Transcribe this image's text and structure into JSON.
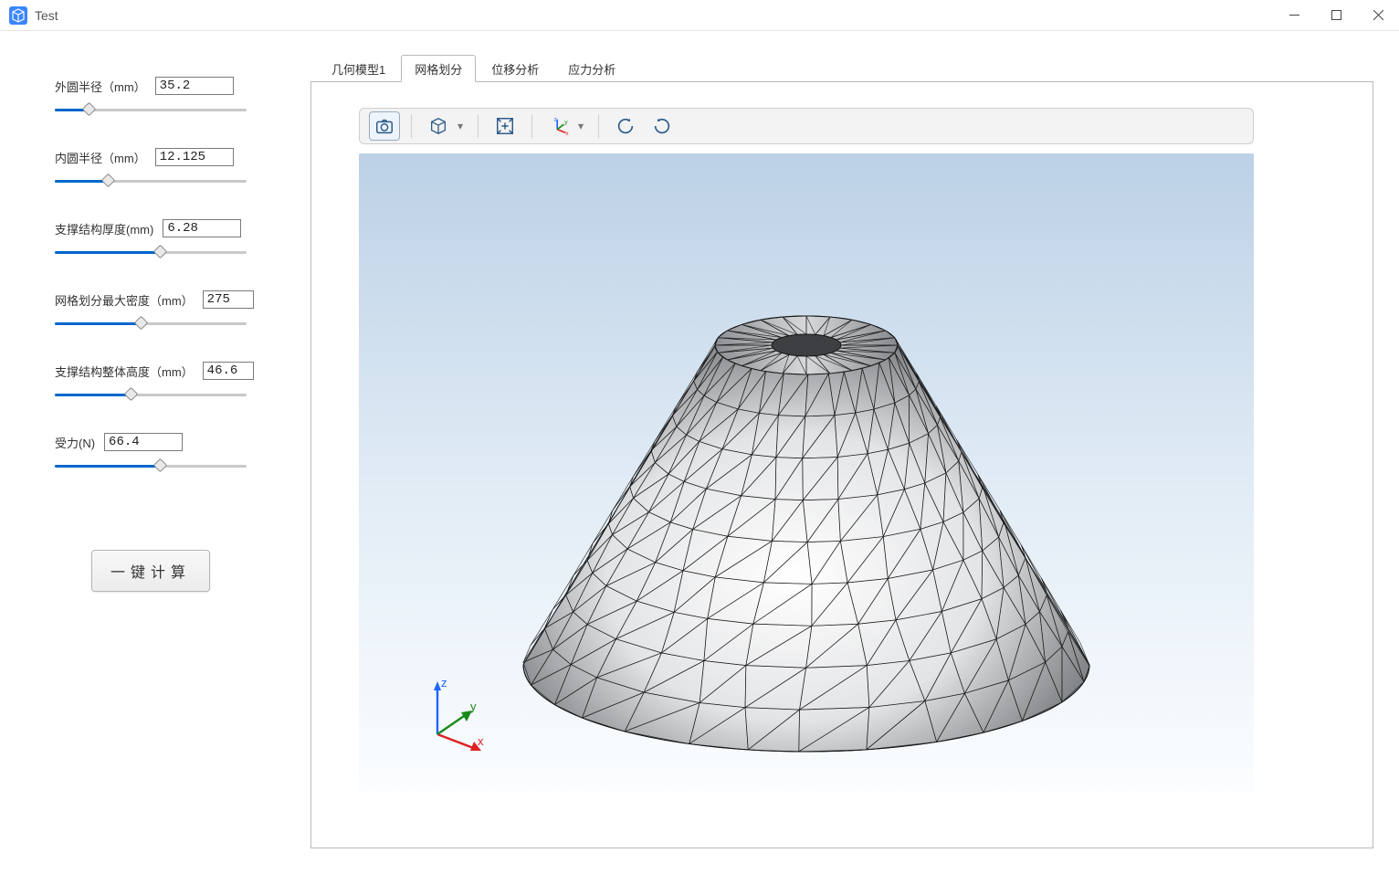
{
  "window": {
    "title": "Test",
    "min": "–",
    "max": "☐",
    "close": "✕"
  },
  "sidebar": {
    "params": [
      {
        "id": "outer-radius",
        "label": "外圆半径（mm）",
        "value": "35.2",
        "pct": 18,
        "wide": false
      },
      {
        "id": "inner-radius",
        "label": "内圆半径（mm）",
        "value": "12.125",
        "pct": 28,
        "wide": false
      },
      {
        "id": "thickness",
        "label": "支撑结构厚度(mm)",
        "value": "6.28",
        "pct": 55,
        "wide": false
      },
      {
        "id": "mesh-density",
        "label": "网格划分最大密度（mm）",
        "value": "275",
        "pct": 45,
        "wide": false,
        "narrow": true
      },
      {
        "id": "height",
        "label": "支撑结构整体高度（mm）",
        "value": "46.6",
        "pct": 40,
        "wide": false,
        "narrow": true
      },
      {
        "id": "force",
        "label": "受力(N)",
        "value": "66.4",
        "pct": 55,
        "wide": true
      }
    ],
    "compute_label": "一键计算"
  },
  "tabs": [
    {
      "id": "geometry",
      "label": "几何模型1",
      "active": false
    },
    {
      "id": "mesh",
      "label": "网格划分",
      "active": true
    },
    {
      "id": "displacement",
      "label": "位移分析",
      "active": false
    },
    {
      "id": "stress",
      "label": "应力分析",
      "active": false
    }
  ],
  "toolbar": {
    "buttons": [
      {
        "id": "screenshot",
        "name": "camera-icon"
      },
      {
        "id": "viewcube",
        "name": "cube-icon",
        "dropdown": true
      },
      {
        "id": "fit",
        "name": "fit-icon"
      },
      {
        "id": "axes",
        "name": "axes-icon",
        "dropdown": true
      },
      {
        "id": "rotate-ccw",
        "name": "rotate-left-icon"
      },
      {
        "id": "rotate-cw",
        "name": "rotate-right-icon"
      }
    ]
  },
  "gizmo": {
    "x": "x",
    "y": "y",
    "z": "z"
  },
  "colors": {
    "accent": "#0066cc",
    "viewport_top": "#bcd1e6",
    "viewport_bottom": "#fbfdff",
    "mesh_stroke": "#111"
  }
}
